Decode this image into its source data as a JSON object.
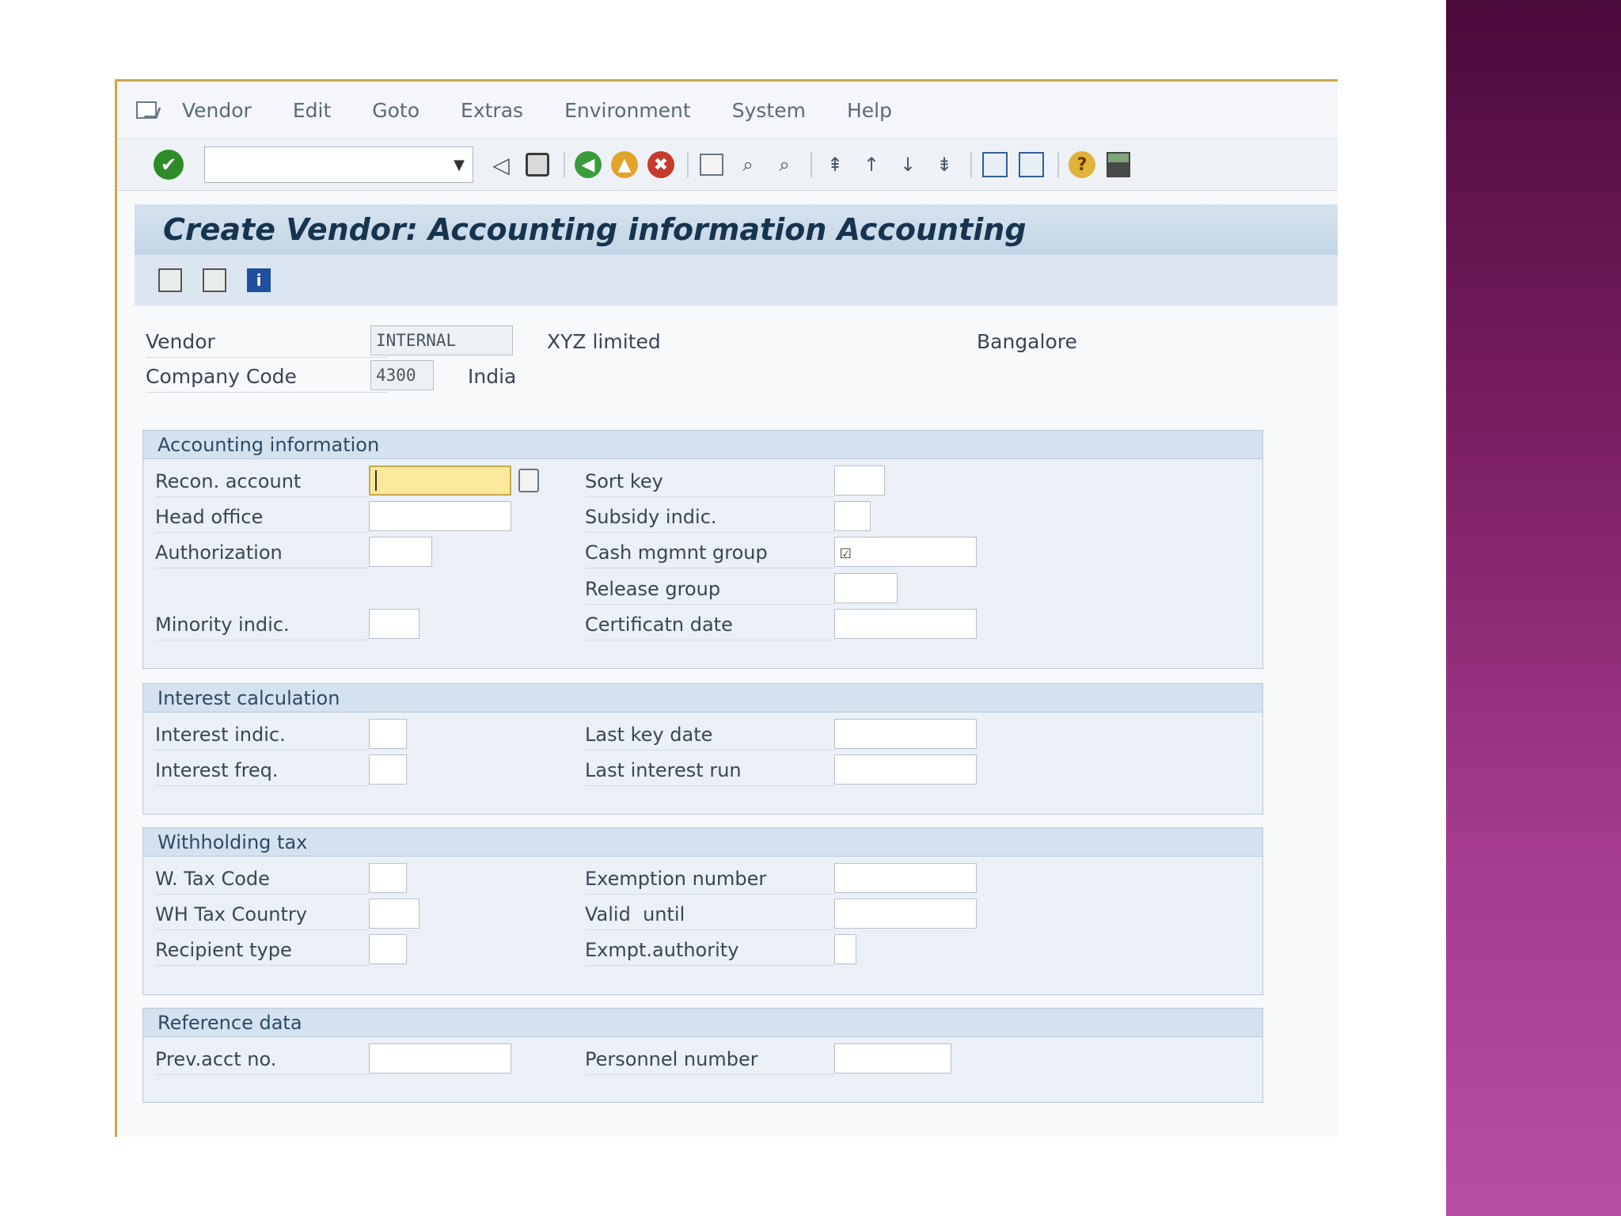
{
  "menu": [
    "Vendor",
    "Edit",
    "Goto",
    "Extras",
    "Environment",
    "System",
    "Help"
  ],
  "toolbar": {
    "command_value": ""
  },
  "title": "Create Vendor: Accounting information Accounting",
  "header": {
    "vendor_label": "Vendor",
    "vendor_value": "INTERNAL",
    "vendor_name": "XYZ limited",
    "vendor_city": "Bangalore",
    "company_label": "Company Code",
    "company_value": "4300",
    "company_country": "India"
  },
  "groups": {
    "accounting": {
      "title": "Accounting information",
      "recon_account": "Recon. account",
      "head_office": "Head office",
      "authorization": "Authorization",
      "minority_indic": "Minority indic.",
      "sort_key": "Sort key",
      "subsidy_indic": "Subsidy indic.",
      "cash_mgmt_group": "Cash mgmnt group",
      "release_group": "Release group",
      "certificatn_date": "Certificatn date"
    },
    "interest": {
      "title": "Interest calculation",
      "interest_indic": "Interest indic.",
      "interest_freq": "Interest freq.",
      "last_key_date": "Last key date",
      "last_interest_run": "Last interest run"
    },
    "withholding": {
      "title": "Withholding tax",
      "w_tax_code": "W. Tax Code",
      "wh_tax_country": "WH Tax Country",
      "recipient_type": "Recipient type",
      "exemption_number": "Exemption number",
      "valid_until": "Valid  until",
      "exmpt_authority": "Exmpt.authority"
    },
    "reference": {
      "title": "Reference data",
      "prev_acct_no": "Prev.acct no.",
      "personnel_number": "Personnel number"
    }
  },
  "colors": {
    "accent_gold": "#c9a84c",
    "title_blue": "#17344f",
    "slide_purple": "#7a1e62"
  }
}
